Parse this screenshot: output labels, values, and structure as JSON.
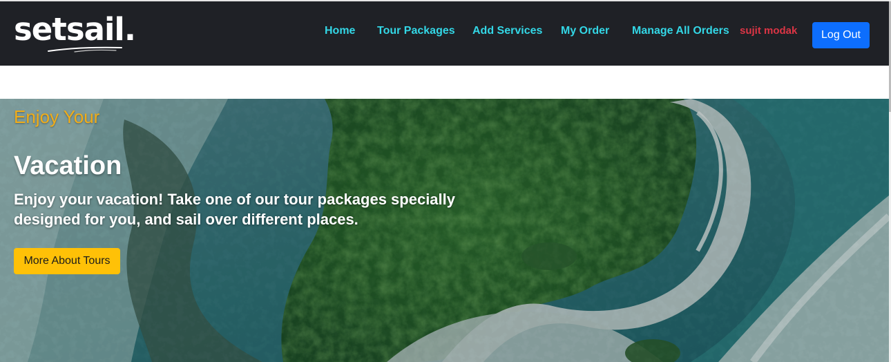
{
  "brand": {
    "name": "setsail."
  },
  "nav": {
    "home": "Home",
    "tour_packages": "Tour Packages",
    "add_services": "Add Services",
    "my_order": "My Order",
    "manage_all_orders": "Manage All Orders"
  },
  "user": {
    "name": "sujit modak",
    "logout_label": "Log Out"
  },
  "hero": {
    "kicker": "Enjoy Your",
    "title": "Vacation",
    "description": "Enjoy your vacation! Take one of our tour packages specially designed for you, and sail over different places.",
    "cta_label": "More About Tours",
    "background": "aerial-island-photo"
  },
  "colors": {
    "nav_link": "#33d7e6",
    "user_name": "#dc3545",
    "logout_button": "#0d6efd",
    "cta_button": "#ffc107",
    "kicker": "#f0ad1a",
    "topbar": "#1f2126"
  }
}
